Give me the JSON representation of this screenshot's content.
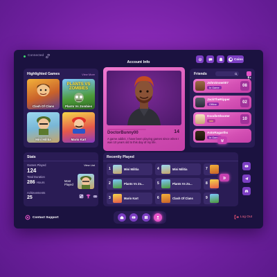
{
  "header": {
    "status": "Connected",
    "title": "Account Info",
    "coins_label": "Coins"
  },
  "highlighted": {
    "title": "Highlighted Games",
    "view_more": "View More",
    "games": [
      "Clash Of Clans",
      "Plants Vs Zombies",
      "Mini Militia",
      "Mario Kart"
    ],
    "thumb_text_pvz": "PLANTS VS ZOMBIES"
  },
  "account": {
    "username": "DoctorBunny00",
    "level": "14",
    "bio": "A game addict, I have been playing games since when I was 10 years old to this day of my life."
  },
  "friends": {
    "title": "Friends",
    "list": [
      {
        "name": "JohnSnow007",
        "status": "In Game",
        "count": "08"
      },
      {
        "name": "JackTheRipper",
        "status": "Offline",
        "count": "02"
      },
      {
        "name": "DoodleShooter",
        "status": "Idle",
        "count": "10"
      },
      {
        "name": "AstoRagarths",
        "status": "In Game",
        "count": ""
      }
    ]
  },
  "stats": {
    "title": "Stats",
    "games_played_label": "Games Played",
    "view_list": "View List",
    "games_played": "124",
    "total_duration_label": "Total Duration",
    "total_duration_value": "286",
    "total_duration_unit": "Hours",
    "most_played_label": "Most Played",
    "achievements_label": "Achievements",
    "achievements": "25"
  },
  "recent": {
    "title": "Recently Played",
    "items": [
      {
        "num": "1",
        "name": "Mini Militia"
      },
      {
        "num": "4",
        "name": "Mini Militia"
      },
      {
        "num": "7",
        "name": ""
      },
      {
        "num": "2",
        "name": "Plants Vs Zo..."
      },
      {
        "num": "5",
        "name": "Plants Vs Zo..."
      },
      {
        "num": "8",
        "name": ""
      },
      {
        "num": "3",
        "name": "Mario Kart"
      },
      {
        "num": "6",
        "name": "Clash Of Clans"
      },
      {
        "num": "9",
        "name": ""
      }
    ]
  },
  "footer": {
    "support": "Contact Support",
    "logout": "Log Out"
  },
  "colors": {
    "accent": "#e653c9",
    "panel": "#2a1c55",
    "frame": "#1b1240",
    "button": "#7b3ec2"
  }
}
